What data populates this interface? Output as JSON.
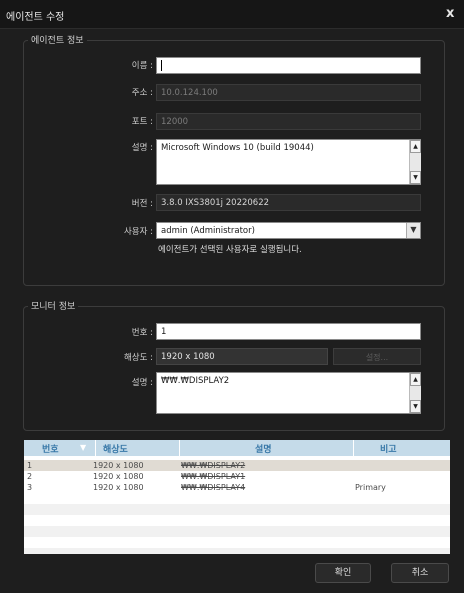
{
  "window": {
    "title": "에이전트 수정",
    "close_label": "x"
  },
  "agent_section": {
    "legend": "에이전트 정보",
    "name_label": "이름 :",
    "name_value": "",
    "address_label": "주소 :",
    "address_value": "10.0.124.100",
    "port_label": "포트 :",
    "port_value": "12000",
    "desc_label": "설명 :",
    "desc_value": "Microsoft Windows 10 (build 19044)",
    "version_label": "버전 :",
    "version_value": "3.8.0 IXS3801j 20220622",
    "user_label": "사용자 :",
    "user_value": "admin (Administrator)",
    "user_note": "에이전트가 선택된 사용자로 실행됩니다."
  },
  "monitor_section": {
    "legend": "모니터 정보",
    "number_label": "번호 :",
    "number_value": "1",
    "resolution_label": "해상도 :",
    "resolution_value": "1920 x 1080",
    "settings_button": "설정...",
    "desc_label": "설명 :",
    "desc_value": "₩₩.₩DISPLAY2"
  },
  "monitor_table": {
    "headers": [
      "번호",
      "해상도",
      "설명",
      "비고"
    ],
    "sort_icon": "▼",
    "rows": [
      {
        "number": "1",
        "resolution": "1920 x 1080",
        "desc": "₩₩.₩DISPLAY2",
        "note": ""
      },
      {
        "number": "2",
        "resolution": "1920 x 1080",
        "desc": "₩₩.₩DISPLAY1",
        "note": ""
      },
      {
        "number": "3",
        "resolution": "1920 x 1080",
        "desc": "₩₩.₩DISPLAY4",
        "note": "Primary"
      }
    ]
  },
  "footer": {
    "ok_label": "확인",
    "cancel_label": "취소"
  },
  "colors": {
    "background": "#1e1e1e",
    "table_header": "#c5dbe9",
    "header_text": "#3878a8",
    "selected_row": "#e0dbd3"
  },
  "icons": {
    "close": "close-icon",
    "scroll_up": "triangle-up-icon",
    "scroll_down": "triangle-down-icon",
    "dropdown": "chevron-down-icon",
    "sort": "sort-down-icon"
  }
}
